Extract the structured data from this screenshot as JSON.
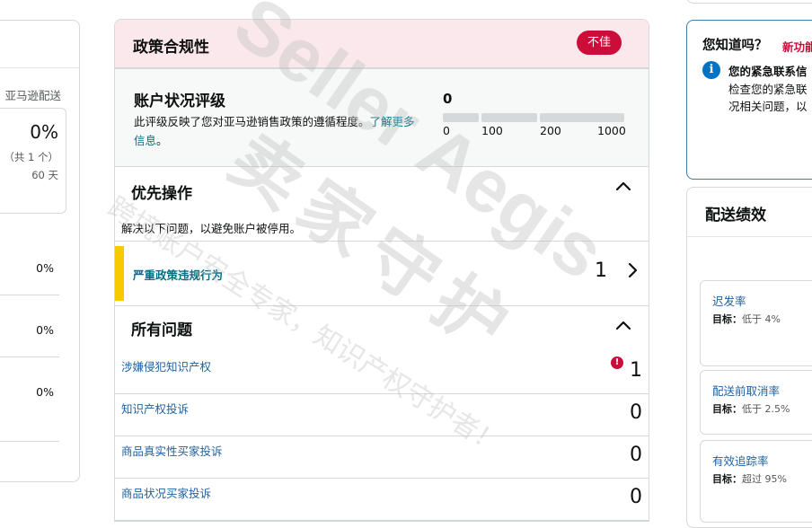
{
  "left_panel": {
    "fba_label": "亚马逊配送",
    "stat_percent": "0%",
    "stat_count": "（共 1 个）",
    "stat_days": "60 天",
    "rows": [
      "0%",
      "0%",
      "0%"
    ]
  },
  "policy": {
    "title": "政策合规性",
    "status_badge": "不佳",
    "account_health": {
      "title": "账户状况评级",
      "description": "此评级反映了您对亚马逊销售政策的遵循程度。",
      "learn_more": "了解更多信息",
      "description_end": "。",
      "score": "0",
      "ticks": [
        "0",
        "100",
        "200",
        "1000"
      ]
    },
    "priority": {
      "title": "优先操作",
      "description": "解决以下问题，以避免账户被停用。",
      "severe_label": "严重政策违规行为",
      "severe_count": "1"
    },
    "all_issues": {
      "title": "所有问题",
      "items": [
        {
          "label": "涉嫌侵犯知识产权",
          "count": "1",
          "alert": true
        },
        {
          "label": "知识产权投诉",
          "count": "0",
          "alert": false
        },
        {
          "label": "商品真实性买家投诉",
          "count": "0",
          "alert": false
        },
        {
          "label": "商品状况买家投诉",
          "count": "0",
          "alert": false
        }
      ]
    }
  },
  "tip": {
    "title": "您知道吗？",
    "new_feature": "新功能",
    "heading": "您的紧急联系信",
    "body_line1": "检查您的紧急联",
    "body_line2": "况相关问题，以"
  },
  "shipping": {
    "title": "配送绩效",
    "target_label": "目标：",
    "metrics": [
      {
        "name": "迟发率",
        "target": "低于 4%"
      },
      {
        "name": "配送前取消率",
        "target": "低于 2.5%"
      },
      {
        "name": "有效追踪率",
        "target": "超过 95%"
      }
    ]
  },
  "watermark": {
    "brand": "Seller Aegis",
    "cn_name": "卖家守护",
    "tagline": "跨境账户安全专家，知识产权守护者！"
  },
  "colors": {
    "danger": "#cc0c39",
    "link": "#007185",
    "warning_bar": "#f7ca00",
    "header_pink": "#fbe8ec"
  }
}
